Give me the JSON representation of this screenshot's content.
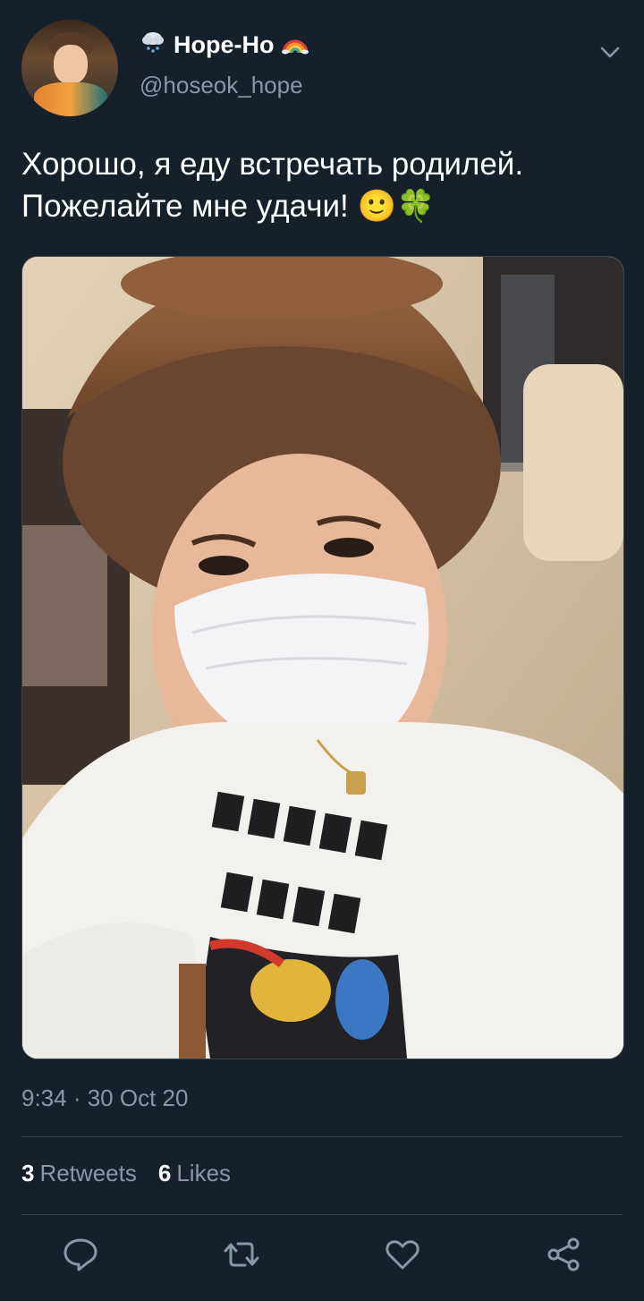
{
  "user": {
    "display_name": "Hope-Ho",
    "handle": "@hoseok_hope",
    "name_prefix_icon": "cloud-snow-icon",
    "name_suffix_icon": "rainbow-icon"
  },
  "tweet": {
    "text": "Хорошо, я еду встречать родилей.\nПожелайте мне удачи! 🙂🍀",
    "image_alt": "selfie-photo",
    "timestamp": "9:34 · 30 Oct 20"
  },
  "stats": {
    "retweets_count": "3",
    "retweets_label": "Retweets",
    "likes_count": "6",
    "likes_label": "Likes"
  },
  "actions": [
    {
      "name": "reply",
      "icon": "speech-bubble-icon"
    },
    {
      "name": "retweet",
      "icon": "retweet-icon"
    },
    {
      "name": "like",
      "icon": "heart-icon"
    },
    {
      "name": "share",
      "icon": "share-icon"
    }
  ],
  "colors": {
    "background": "#15202b",
    "secondary_text": "#8899a6",
    "divider": "#38444d",
    "primary_text": "#ffffff"
  }
}
